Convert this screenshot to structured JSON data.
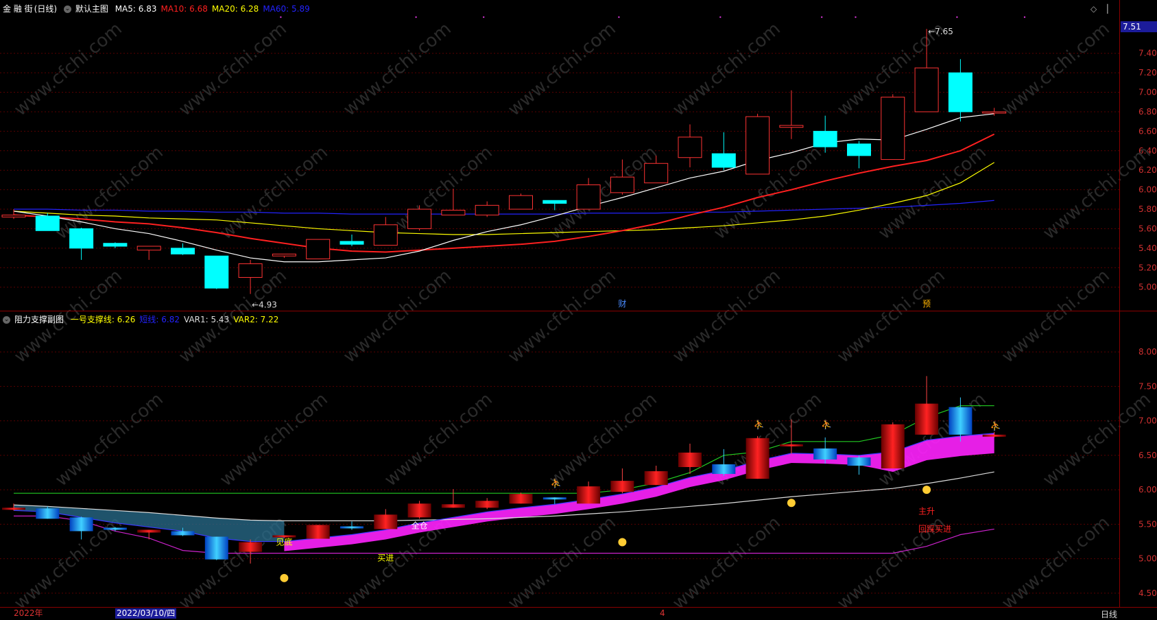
{
  "main_panel": {
    "stock_name": "金 融 街",
    "period_tag": "(日线)",
    "indicator_name": "默认主图",
    "ma_items": [
      {
        "label": "MA5:",
        "value": "6.83",
        "color": "#ffffff"
      },
      {
        "label": "MA10:",
        "value": "6.68",
        "color": "#ff2020"
      },
      {
        "label": "MA20:",
        "value": "6.28",
        "color": "#ffff00"
      },
      {
        "label": "MA60:",
        "value": "5.89",
        "color": "#2323ff"
      }
    ],
    "price_axis_ticks": [
      "7.51",
      "7.40",
      "7.20",
      "7.00",
      "6.80",
      "6.60",
      "6.40",
      "6.20",
      "6.00",
      "5.80",
      "5.60",
      "5.40",
      "5.20",
      "5.00"
    ],
    "current_price_tag": "7.51",
    "high_marker": "7.65",
    "low_marker": "4.93",
    "event_labels": [
      "财",
      "预"
    ]
  },
  "sub_panel": {
    "indicator_name": "阻力支撑副图",
    "items": [
      {
        "label": "一号支撑线:",
        "value": "6.26",
        "color": "#ffff00"
      },
      {
        "label": "短线:",
        "value": "6.82",
        "color": "#2323ff"
      },
      {
        "label": "VAR1:",
        "value": "5.43",
        "color": "#dddddd"
      },
      {
        "label": "VAR2:",
        "value": "7.22",
        "color": "#ffff00"
      }
    ],
    "axis_ticks": [
      "8.00",
      "7.50",
      "7.00",
      "6.50",
      "6.00",
      "5.50",
      "5.00",
      "4.50"
    ],
    "signals": [
      "见底",
      "买进",
      "全仓",
      "主升",
      "回踩买进"
    ]
  },
  "bottom_bar": {
    "year_label": "2022年",
    "cursor_date": "2022/03/10/四",
    "month_label": "4",
    "period_label": "日线"
  },
  "watermark": "www.cfchi.com",
  "colors": {
    "up": "#ff3333",
    "down": "#00ffff",
    "ma5": "#ffffff",
    "ma10": "#ff2020",
    "ma20": "#ffff00",
    "ma60": "#2323ff",
    "grid": "#5a0000",
    "axis_text": "#d03030"
  },
  "chart_data": {
    "type": "candlestick",
    "dates": [
      "2022-02-22",
      "2022-02-23",
      "2022-02-24",
      "2022-02-25",
      "2022-02-28",
      "2022-03-01",
      "2022-03-02",
      "2022-03-03",
      "2022-03-04",
      "2022-03-07",
      "2022-03-08",
      "2022-03-09",
      "2022-03-10",
      "2022-03-11",
      "2022-03-14",
      "2022-03-15",
      "2022-03-16",
      "2022-03-17",
      "2022-03-18",
      "2022-03-21",
      "2022-03-22",
      "2022-03-23",
      "2022-03-24",
      "2022-03-25",
      "2022-03-28",
      "2022-03-29",
      "2022-03-30",
      "2022-03-31",
      "2022-04-01",
      "2022-04-06"
    ],
    "ohlc": [
      [
        5.72,
        5.8,
        5.7,
        5.74
      ],
      [
        5.73,
        5.76,
        5.58,
        5.58
      ],
      [
        5.6,
        5.61,
        5.28,
        5.4
      ],
      [
        5.45,
        5.46,
        5.4,
        5.42
      ],
      [
        5.38,
        5.42,
        5.28,
        5.42
      ],
      [
        5.4,
        5.45,
        5.33,
        5.34
      ],
      [
        5.32,
        5.32,
        4.98,
        4.99
      ],
      [
        5.1,
        5.28,
        4.93,
        5.24
      ],
      [
        5.32,
        5.34,
        5.3,
        5.34
      ],
      [
        5.29,
        5.49,
        5.29,
        5.49
      ],
      [
        5.47,
        5.54,
        5.42,
        5.44
      ],
      [
        5.43,
        5.72,
        5.43,
        5.64
      ],
      [
        5.6,
        5.84,
        5.58,
        5.8
      ],
      [
        5.74,
        6.01,
        5.74,
        5.79
      ],
      [
        5.74,
        5.88,
        5.72,
        5.84
      ],
      [
        5.8,
        5.96,
        5.8,
        5.94
      ],
      [
        5.89,
        5.89,
        5.79,
        5.86
      ],
      [
        5.8,
        6.12,
        5.8,
        6.05
      ],
      [
        5.97,
        6.31,
        5.95,
        6.13
      ],
      [
        6.07,
        6.35,
        6.07,
        6.27
      ],
      [
        6.33,
        6.67,
        6.23,
        6.54
      ],
      [
        6.37,
        6.59,
        6.2,
        6.23
      ],
      [
        6.16,
        6.78,
        6.16,
        6.75
      ],
      [
        6.64,
        7.02,
        6.52,
        6.66
      ],
      [
        6.6,
        6.76,
        6.38,
        6.44
      ],
      [
        6.47,
        6.5,
        6.22,
        6.35
      ],
      [
        6.31,
        6.98,
        6.31,
        6.95
      ],
      [
        6.8,
        7.65,
        6.8,
        7.25
      ],
      [
        7.2,
        7.34,
        6.7,
        6.8
      ],
      [
        6.8,
        6.84,
        6.76,
        6.8
      ]
    ],
    "ma5": [
      5.78,
      5.73,
      5.67,
      5.6,
      5.55,
      5.47,
      5.38,
      5.3,
      5.26,
      5.26,
      5.28,
      5.3,
      5.37,
      5.48,
      5.57,
      5.64,
      5.73,
      5.83,
      5.92,
      6.02,
      6.12,
      6.19,
      6.3,
      6.38,
      6.48,
      6.52,
      6.51,
      6.62,
      6.74,
      6.78
    ],
    "ma10": [
      5.74,
      5.72,
      5.7,
      5.67,
      5.65,
      5.61,
      5.56,
      5.5,
      5.45,
      5.4,
      5.37,
      5.36,
      5.38,
      5.4,
      5.42,
      5.44,
      5.47,
      5.52,
      5.58,
      5.65,
      5.74,
      5.82,
      5.92,
      6.0,
      6.09,
      6.17,
      6.24,
      6.3,
      6.4,
      6.57
    ],
    "ma20": [
      5.78,
      5.76,
      5.74,
      5.73,
      5.71,
      5.7,
      5.69,
      5.66,
      5.63,
      5.6,
      5.58,
      5.56,
      5.55,
      5.54,
      5.54,
      5.55,
      5.56,
      5.57,
      5.58,
      5.59,
      5.61,
      5.63,
      5.66,
      5.69,
      5.73,
      5.79,
      5.86,
      5.94,
      6.07,
      6.28
    ],
    "ma60": [
      5.8,
      5.8,
      5.79,
      5.79,
      5.78,
      5.78,
      5.77,
      5.77,
      5.76,
      5.76,
      5.75,
      5.75,
      5.75,
      5.75,
      5.75,
      5.75,
      5.75,
      5.76,
      5.76,
      5.76,
      5.77,
      5.77,
      5.78,
      5.79,
      5.8,
      5.81,
      5.82,
      5.84,
      5.86,
      5.89
    ],
    "ylim": [
      4.85,
      7.75
    ],
    "sub_support1": [
      5.78,
      5.76,
      5.73,
      5.7,
      5.67,
      5.63,
      5.59,
      5.56,
      5.55,
      5.55,
      5.55,
      5.55,
      5.56,
      5.57,
      5.58,
      5.6,
      5.62,
      5.65,
      5.68,
      5.72,
      5.76,
      5.8,
      5.85,
      5.9,
      5.94,
      5.98,
      6.02,
      6.09,
      6.17,
      6.26
    ],
    "sub_short": [
      5.7,
      5.68,
      5.6,
      5.52,
      5.46,
      5.4,
      5.3,
      5.25,
      5.25,
      5.3,
      5.35,
      5.42,
      5.52,
      5.6,
      5.68,
      5.74,
      5.79,
      5.86,
      5.94,
      6.04,
      6.18,
      6.28,
      6.42,
      6.53,
      6.52,
      6.5,
      6.55,
      6.72,
      6.78,
      6.82
    ],
    "sub_var2_low": [
      5.62,
      5.62,
      5.55,
      5.4,
      5.3,
      5.12,
      5.08,
      5.08,
      5.08,
      5.08,
      5.08,
      5.08,
      5.08,
      5.08,
      5.08,
      5.08,
      5.08,
      5.08,
      5.08,
      5.08,
      5.08,
      5.08,
      5.08,
      5.08,
      5.08,
      5.08,
      5.08,
      5.18,
      5.35,
      5.43
    ],
    "sub_green": [
      5.95,
      5.95,
      5.95,
      5.95,
      5.95,
      5.95,
      5.95,
      5.95,
      5.95,
      5.95,
      5.95,
      5.95,
      5.95,
      5.95,
      5.95,
      5.95,
      5.95,
      5.95,
      6.0,
      6.1,
      6.25,
      6.5,
      6.55,
      6.7,
      6.7,
      6.7,
      6.8,
      7.05,
      7.22,
      7.22
    ],
    "sub_ylim": [
      4.35,
      8.35
    ]
  }
}
